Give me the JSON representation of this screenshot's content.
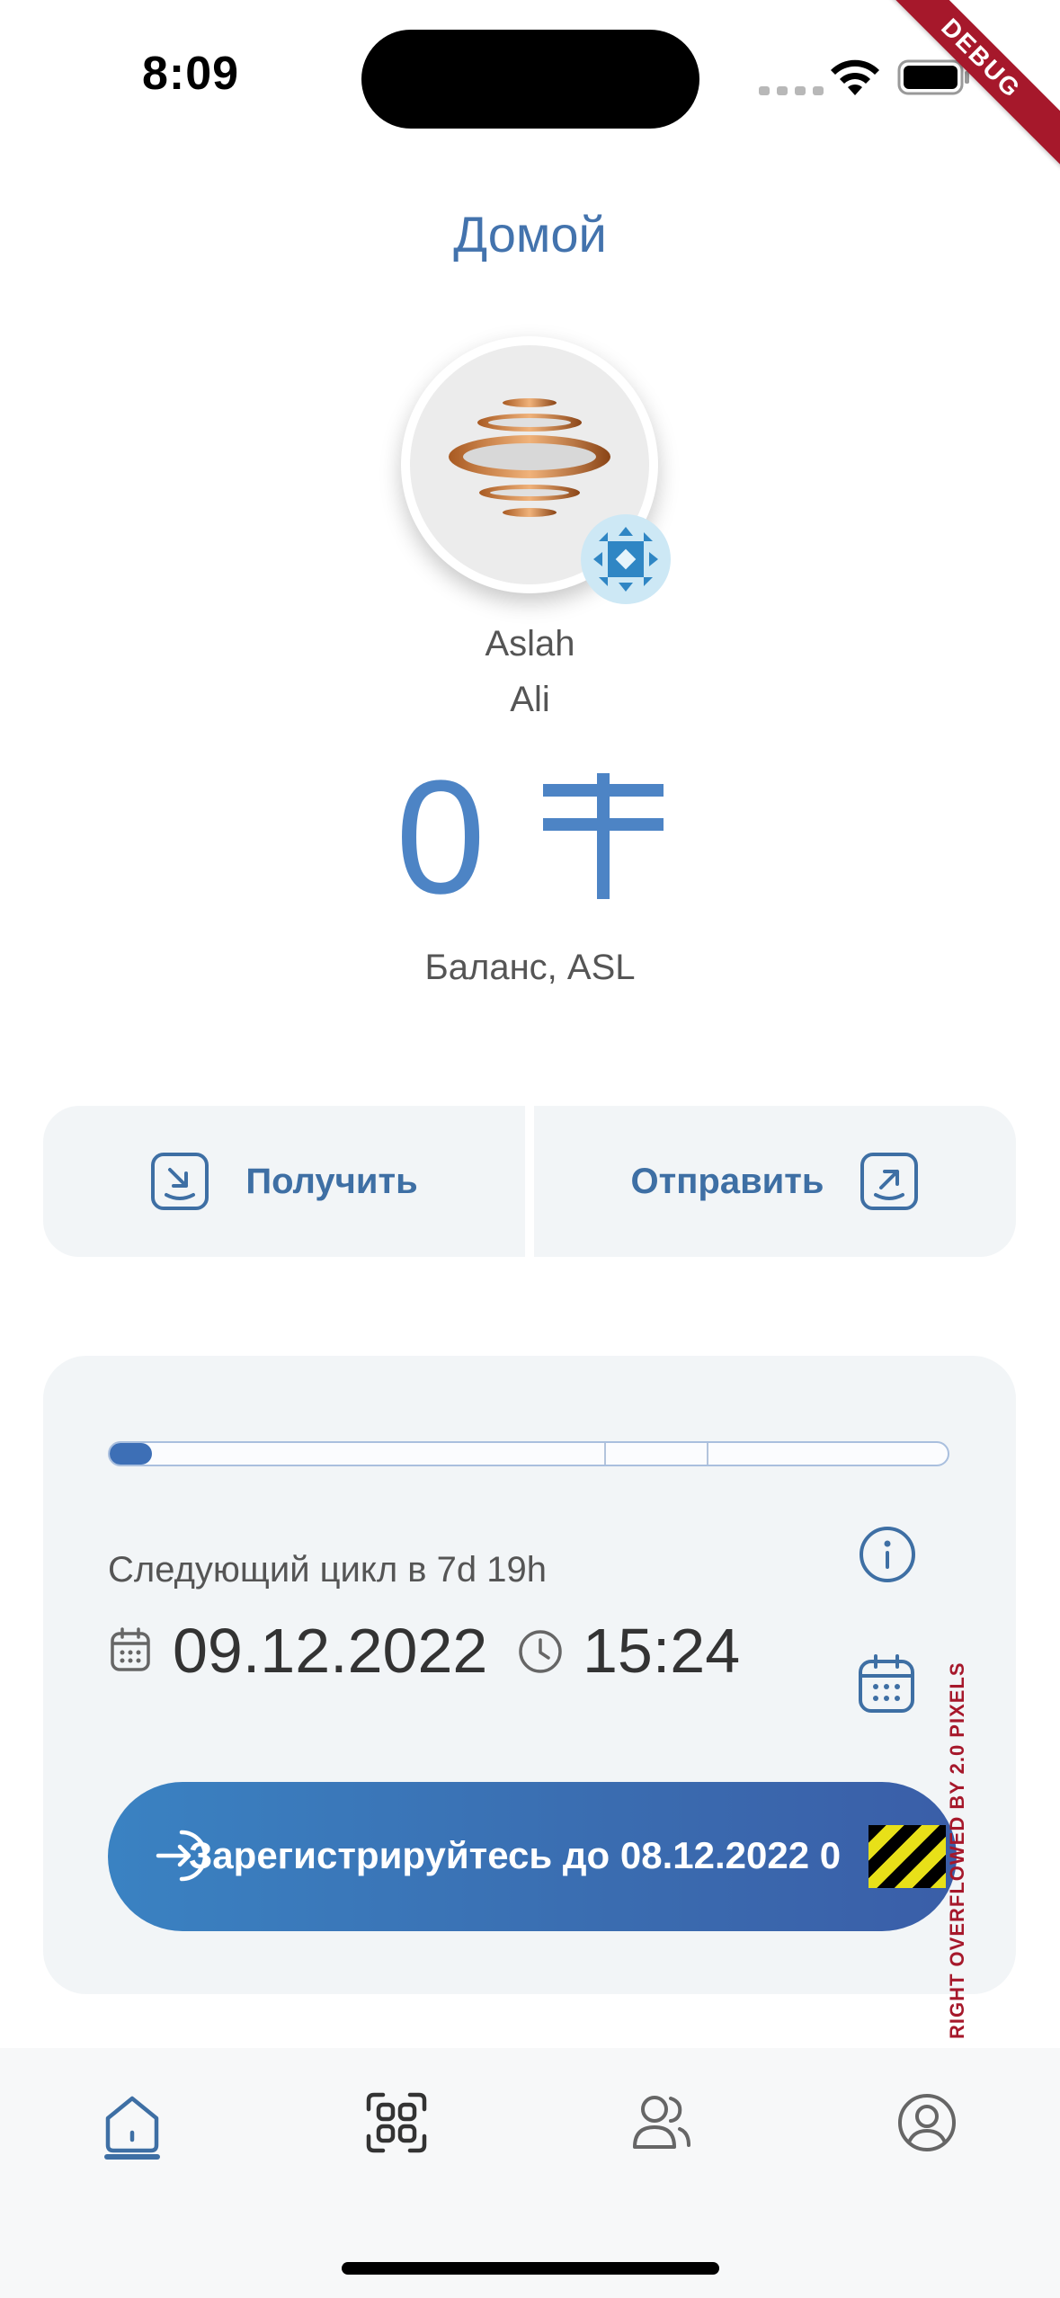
{
  "status_bar": {
    "time": "8:09"
  },
  "debug_ribbon": "DEBUG",
  "header": {
    "title": "Домой"
  },
  "user": {
    "first_name": "Aslah",
    "last_name": "Ali"
  },
  "balance": {
    "amount": "0",
    "label": "Баланс, ASL",
    "currency_icon": "tenge-sign-icon"
  },
  "actions": {
    "receive_label": "Получить",
    "send_label": "Отправить"
  },
  "cycle": {
    "progress_fraction": 0.05,
    "next_cycle_text": "Следующий цикл в 7d 19h",
    "date": "09.12.2022",
    "time": "15:24",
    "register_label": "Зарегистрируйтесь до 08.12.2022 0"
  },
  "overflow_warning": "RIGHT OVERFLOWED BY 2.0 PIXELS",
  "nav": {
    "items": [
      "home-icon",
      "scan-icon",
      "friends-icon",
      "profile-icon"
    ],
    "active": "home-icon"
  },
  "colors": {
    "accent": "#3e6fa4",
    "balance": "#4d84c5",
    "card": "#f2f5f7",
    "debug": "#a6182b"
  }
}
